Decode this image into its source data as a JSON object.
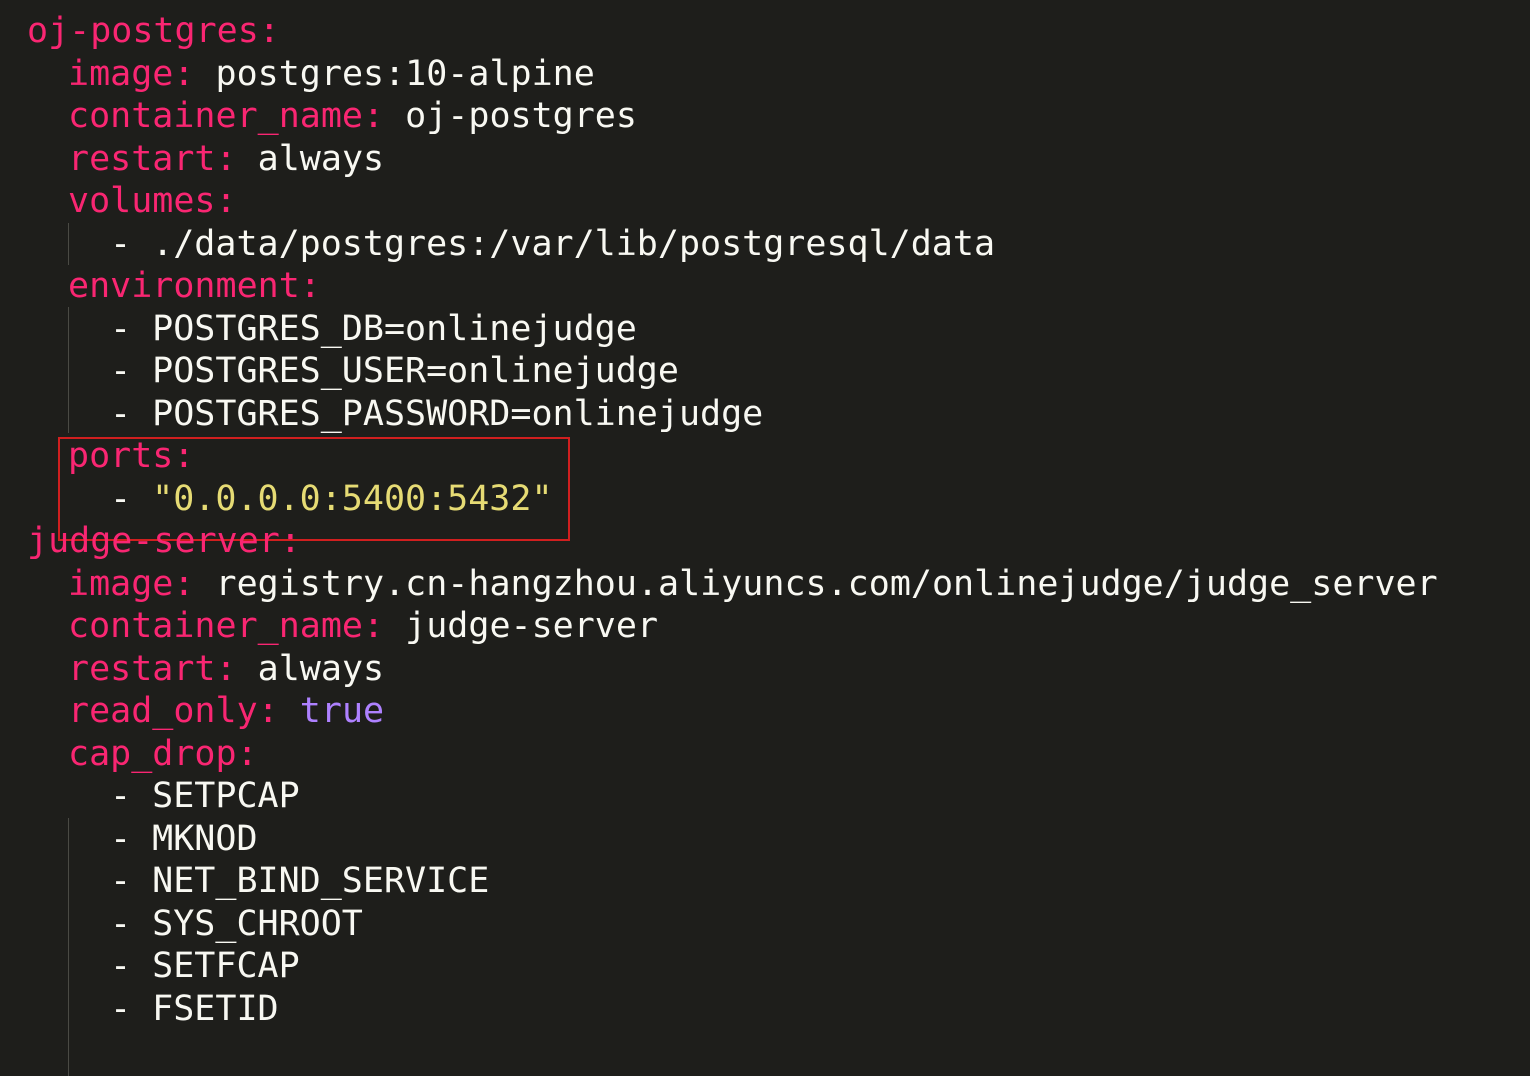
{
  "theme": {
    "background": "#1e1e1b",
    "key_color": "#f92672",
    "string_color": "#e6db74",
    "boolean_color": "#ae81ff",
    "text_color": "#f8f8f2",
    "highlight_border": "#d11f1f"
  },
  "lines": [
    {
      "indent": 0,
      "key": "oj-postgres:"
    },
    {
      "indent": 1,
      "key": "image:",
      "value": "postgres:10-alpine"
    },
    {
      "indent": 1,
      "key": "container_name:",
      "value": "oj-postgres"
    },
    {
      "indent": 1,
      "key": "restart:",
      "value": "always"
    },
    {
      "indent": 1,
      "key": "volumes:"
    },
    {
      "indent": 2,
      "item": "./data/postgres:/var/lib/postgresql/data"
    },
    {
      "indent": 1,
      "key": "environment:"
    },
    {
      "indent": 2,
      "item": "POSTGRES_DB=onlinejudge"
    },
    {
      "indent": 2,
      "item": "POSTGRES_USER=onlinejudge"
    },
    {
      "indent": 2,
      "item": "POSTGRES_PASSWORD=onlinejudge"
    },
    {
      "indent": 1,
      "key": "ports:"
    },
    {
      "indent": 2,
      "item": "\"0.0.0.0:5400:5432\"",
      "item_type": "string"
    },
    {
      "indent": 0,
      "key": "judge-server:"
    },
    {
      "indent": 1,
      "key": "image:",
      "value": "registry.cn-hangzhou.aliyuncs.com/onlinejudge/judge_server"
    },
    {
      "indent": 1,
      "key": "container_name:",
      "value": "judge-server"
    },
    {
      "indent": 1,
      "key": "restart:",
      "value": "always"
    },
    {
      "indent": 1,
      "key": "read_only:",
      "value": "true",
      "value_type": "boolean"
    },
    {
      "indent": 1,
      "key": "cap_drop:"
    },
    {
      "indent": 2,
      "item": "SETPCAP"
    },
    {
      "indent": 2,
      "item": "MKNOD"
    },
    {
      "indent": 2,
      "item": "NET_BIND_SERVICE"
    },
    {
      "indent": 2,
      "item": "SYS_CHROOT"
    },
    {
      "indent": 2,
      "item": "SETFCAP"
    },
    {
      "indent": 2,
      "item": "FSETID"
    }
  ]
}
